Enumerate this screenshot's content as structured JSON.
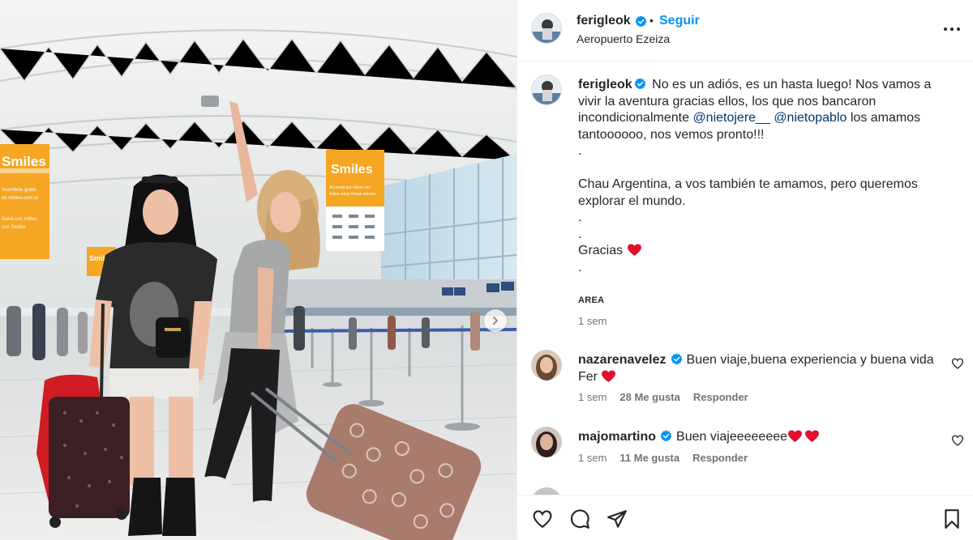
{
  "post": {
    "username": "ferigleok",
    "follow_label": "Seguir",
    "separator": "•",
    "location": "Aeropuerto Ezeiza"
  },
  "photo": {
    "sign_left_brand": "Smiles",
    "sign_left_line1": "Inscríbete gratis",
    "sign_left_line2": "en smiles.com.ar",
    "sign_left_line3": "Ganá con millas,",
    "sign_left_line4": "con Smiles.",
    "sign_center_brand": "Smiles",
    "sign_center_line1": "Acumulá tus millas con",
    "sign_center_line2": "todas estas líneas aéreas",
    "sign_small_brand": "Smiles"
  },
  "caption": {
    "username": "ferigleok",
    "line1_text": "No es un adiós, es un hasta luego! Nos vamos a vivir la aventura gracias ellos, los que nos bancaron incondicionalmente",
    "mention1": "@nietojere__",
    "mention2": "@nietopablo",
    "line1_tail": "los amamos tantoooooo, nos vemos pronto!!!",
    "dot1": ".",
    "paragraph2": "Chau Argentina, a vos también te amamos, pero queremos explorar el mundo.",
    "dot2": ".",
    "dot3": ".",
    "thanks": "Gracias",
    "dot4": ".",
    "area_tag": "AREA",
    "time": "1 sem"
  },
  "comments": [
    {
      "username": "nazarenavelez",
      "text": "Buen viaje,buena experiencia y buena vida Fer",
      "time": "1 sem",
      "likes": "28 Me gusta",
      "reply": "Responder"
    },
    {
      "username": "majomartino",
      "text": "Buen viajeeeeeeee",
      "time": "1 sem",
      "likes": "11 Me gusta",
      "reply": "Responder"
    }
  ],
  "icons": {
    "verified": "verified-badge-icon",
    "more": "more-options-icon",
    "like": "heart-icon",
    "comment": "comment-icon",
    "share": "share-icon",
    "save": "bookmark-icon",
    "next": "chevron-right-icon"
  },
  "colors": {
    "accent": "#0095f6",
    "mention": "#00376b",
    "secondary_text": "#737373",
    "verified_blue": "#0095f6",
    "heart_red": "#e0102f",
    "smiles_orange": "#f5a623"
  }
}
